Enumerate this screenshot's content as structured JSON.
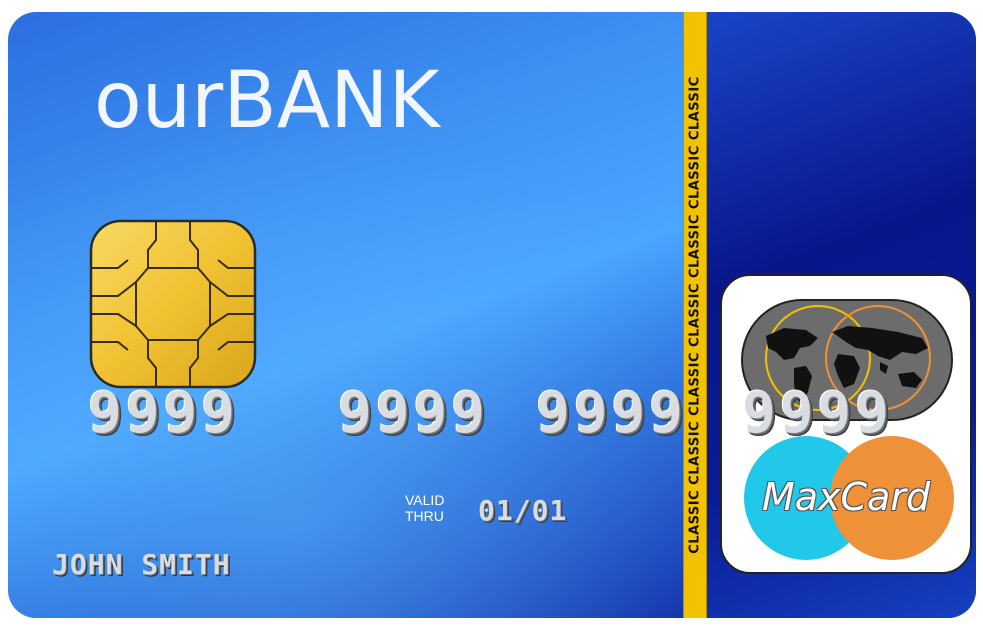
{
  "card": {
    "bank_name": "ourBANK",
    "number_groups": [
      "9999",
      "9999",
      "9999",
      "9999"
    ],
    "valid_label_line1": "VALID",
    "valid_label_line2": "THRU",
    "valid_thru": "01/01",
    "cardholder_name": "JOHN SMITH",
    "stripe_text": "CLASSIC CLASSIC CLASSIC CLASSIC CLASSIC CLASSIC CLASSIC",
    "brand_logo_text": "MaxCard"
  },
  "icons": {
    "chip": "emv-chip-icon",
    "world_map": "world-map-icon",
    "brand_circles": "overlapping-circles-icon"
  },
  "colors": {
    "card_blue": "#2c6ee0",
    "card_dark_blue": "#06137f",
    "stripe_yellow": "#f2c200",
    "chip_gold": "#f0c232",
    "logo_cyan": "#22c8ea",
    "logo_orange": "#ef9138"
  }
}
